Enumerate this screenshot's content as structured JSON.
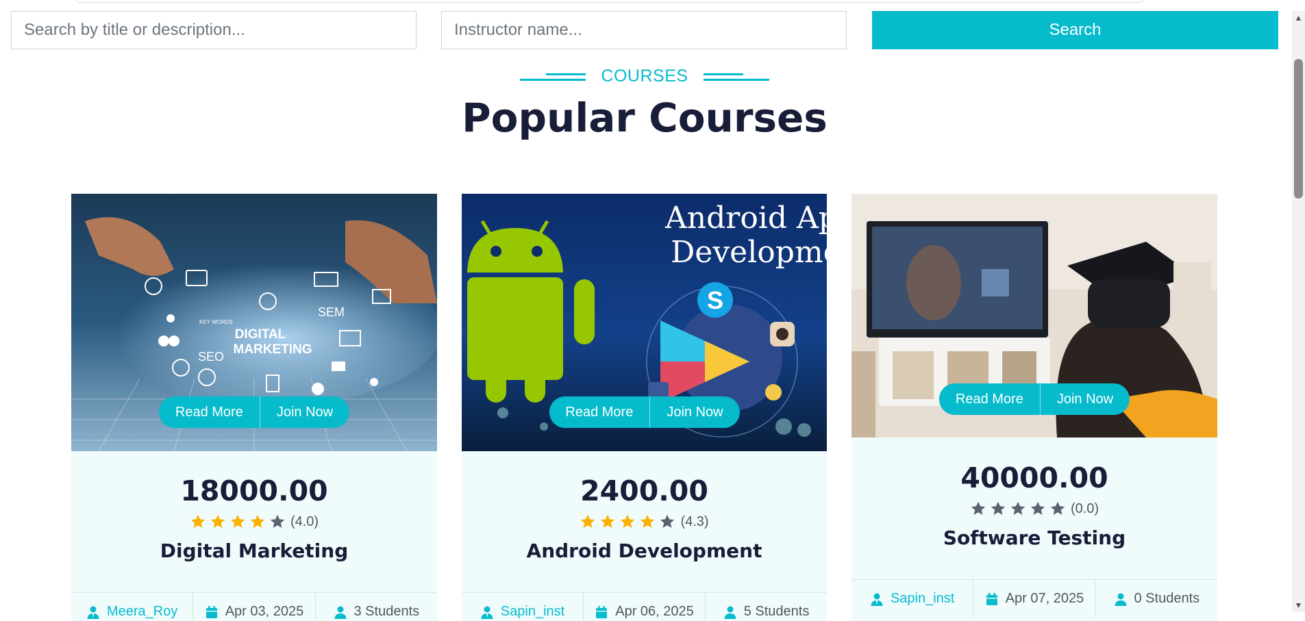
{
  "search": {
    "title_placeholder": "Search by title or description...",
    "instructor_placeholder": "Instructor name...",
    "button_label": "Search"
  },
  "section": {
    "subtitle": "COURSES",
    "title": "Popular Courses"
  },
  "courses": [
    {
      "price": "18000.00",
      "rating": 4.0,
      "rating_text": "(4.0)",
      "name": "Digital Marketing",
      "instructor": "Meera_Roy",
      "date": "Apr 03, 2025",
      "students": "3 Students",
      "read_more": "Read More",
      "join_now": "Join Now",
      "image_labels": [
        "DIGITAL",
        "MARKETING",
        "SEO",
        "SEM",
        "KEY WORDS"
      ]
    },
    {
      "price": "2400.00",
      "rating": 4.3,
      "rating_text": "(4.3)",
      "name": "Android Development",
      "instructor": "Sapin_inst",
      "date": "Apr 06, 2025",
      "students": "5 Students",
      "read_more": "Read More",
      "join_now": "Join Now",
      "image_labels": [
        "Android App",
        "Developmen"
      ]
    },
    {
      "price": "40000.00",
      "rating": 0.0,
      "rating_text": "(0.0)",
      "name": "Software Testing",
      "instructor": "Sapin_inst",
      "date": "Apr 07, 2025",
      "students": "0 Students",
      "read_more": "Read More",
      "join_now": "Join Now",
      "image_labels": []
    }
  ],
  "colors": {
    "primary": "#06bbcc",
    "dark": "#181d38",
    "card_bg": "#f0fbfc",
    "star_filled": "#fbb100",
    "star_empty": "#5b6270"
  }
}
